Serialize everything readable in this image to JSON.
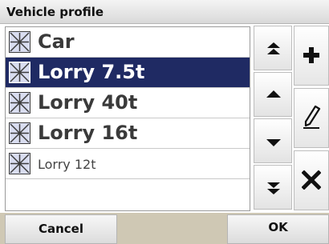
{
  "title": "Vehicle profile",
  "profiles": [
    {
      "label": "Car",
      "selected": false,
      "icon": "vehicle-icon"
    },
    {
      "label": "Lorry 7.5t",
      "selected": true,
      "icon": "vehicle-icon"
    },
    {
      "label": "Lorry 40t",
      "selected": false,
      "icon": "vehicle-icon"
    },
    {
      "label": "Lorry 16t",
      "selected": false,
      "icon": "vehicle-icon"
    },
    {
      "label": "Lorry 12t",
      "selected": false,
      "icon": "vehicle-icon"
    }
  ],
  "scroll_buttons": [
    "scroll-top-icon",
    "scroll-up-icon",
    "scroll-down-icon",
    "scroll-bottom-icon"
  ],
  "action_buttons": [
    "add-icon",
    "edit-pen-icon",
    "delete-icon"
  ],
  "footer": {
    "cancel_label": "Cancel",
    "ok_label": "OK"
  },
  "colors": {
    "selection": "#1f2a63",
    "background": "#ffffff",
    "footer_bar": "#cfc8b4"
  }
}
